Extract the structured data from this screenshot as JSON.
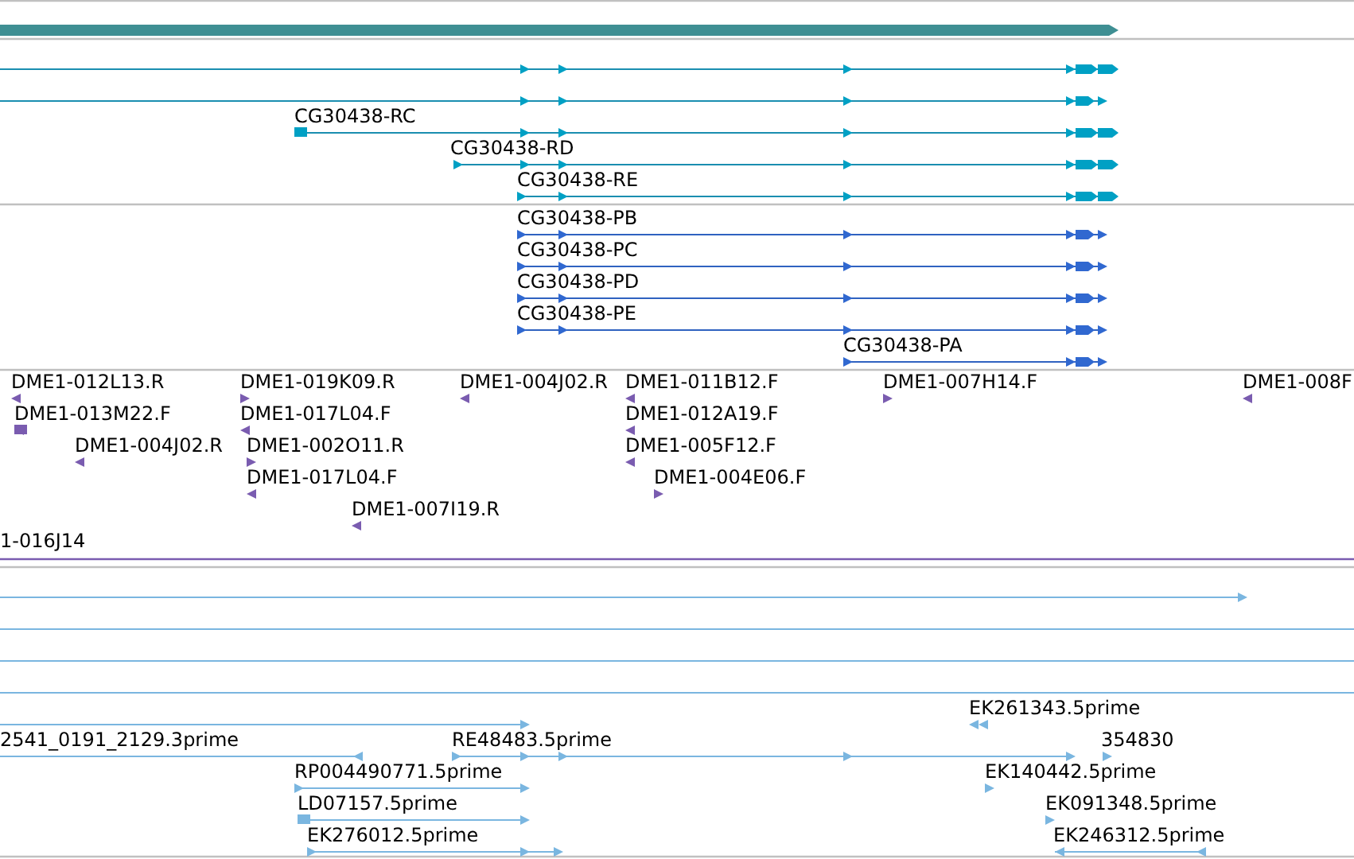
{
  "tracks": [
    {
      "kind": "gene",
      "features": [
        {
          "reverse": false
        }
      ]
    },
    {
      "kind": "transcript",
      "features": [
        {
          "reverse": false
        },
        {
          "reverse": false
        },
        {
          "label": "CG30438-RC",
          "reverse": false
        },
        {
          "label": "CG30438-RD",
          "reverse": false
        },
        {
          "label": "CG30438-RE",
          "reverse": false
        }
      ]
    },
    {
      "kind": "protein",
      "features": [
        {
          "label": "CG30438-PB",
          "reverse": false
        },
        {
          "label": "CG30438-PC",
          "reverse": false
        },
        {
          "label": "CG30438-PD",
          "reverse": false
        },
        {
          "label": "CG30438-PE",
          "reverse": false
        },
        {
          "label": "CG30438-PA",
          "reverse": false
        }
      ]
    },
    {
      "kind": "clone",
      "features": [
        {
          "label": "DME1-012L13.R",
          "reverse": true
        },
        {
          "label": "DME1-013M22.F",
          "reverse": true
        },
        {
          "label": "DME1-004J02.R",
          "reverse": true
        },
        {
          "label": "DME1-019K09.R",
          "reverse": false
        },
        {
          "label": "DME1-017L04.F",
          "reverse": true
        },
        {
          "label": "DME1-002O11.R",
          "reverse": false
        },
        {
          "label": "DME1-017L04.F",
          "reverse": true
        },
        {
          "label": "DME1-007I19.R",
          "reverse": true
        },
        {
          "label": "DME1-004J02.R",
          "reverse": true
        },
        {
          "label": "DME1-011B12.F",
          "reverse": true
        },
        {
          "label": "DME1-012A19.F",
          "reverse": true
        },
        {
          "label": "DME1-005F12.F",
          "reverse": true
        },
        {
          "label": "DME1-004E06.F",
          "reverse": false
        },
        {
          "label": "DME1-007H14.F",
          "reverse": false
        },
        {
          "label": "DME1-008F",
          "reverse": true
        },
        {
          "label": "1-016J14"
        }
      ]
    },
    {
      "kind": "est",
      "features": [
        {
          "kind": "alignment",
          "reverse": false
        },
        {
          "kind": "span"
        },
        {
          "kind": "span"
        },
        {
          "kind": "span"
        },
        {
          "kind": "alignment",
          "reverse": false
        },
        {
          "kind": "alignment",
          "label": "2541_0191_2129.3prime",
          "reverse": true
        },
        {
          "kind": "alignment",
          "label": "RE48483.5prime",
          "reverse": false
        },
        {
          "kind": "alignment",
          "label": "EK261343.5prime",
          "reverse": true
        },
        {
          "kind": "alignment",
          "label": "354830",
          "reverse": false
        },
        {
          "kind": "alignment",
          "label": "RP004490771.5prime",
          "reverse": false
        },
        {
          "kind": "alignment",
          "label": "EK140442.5prime",
          "reverse": false
        },
        {
          "kind": "alignment",
          "label": "LD07157.5prime",
          "reverse": false
        },
        {
          "kind": "alignment",
          "label": "EK091348.5prime",
          "reverse": false
        },
        {
          "kind": "alignment",
          "label": "EK276012.5prime",
          "reverse": false
        },
        {
          "kind": "alignment",
          "label": "EK246312.5prime",
          "reverse": true
        }
      ]
    }
  ]
}
